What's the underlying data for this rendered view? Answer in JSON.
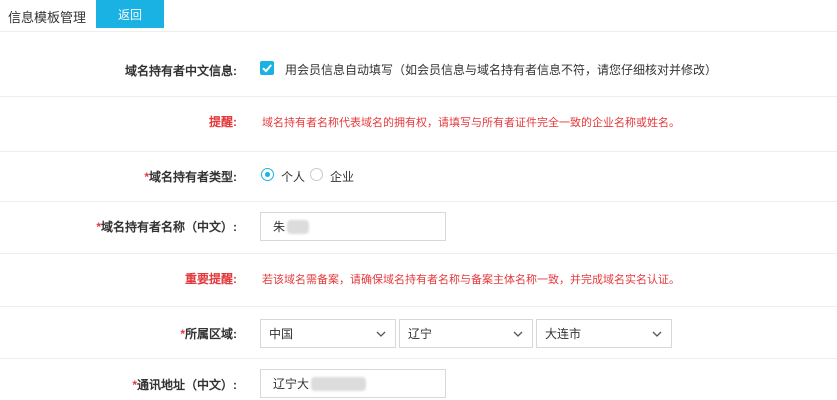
{
  "header": {
    "title": "信息模板管理",
    "back_label": "返回"
  },
  "form": {
    "owner_cn_info": {
      "label": "域名持有者中文信息:",
      "checkbox_text": "用会员信息自动填写（如会员信息与域名持有者信息不符，请您仔细核对并修改）",
      "checked": true
    },
    "reminder": {
      "label": "提醒:",
      "text": "域名持有者名称代表域名的拥有权，请填写与所有者证件完全一致的企业名称或姓名。"
    },
    "owner_type": {
      "required_mark": "*",
      "label": "域名持有者类型:",
      "options": [
        "个人",
        "企业"
      ],
      "selected": "个人"
    },
    "owner_name": {
      "required_mark": "*",
      "label": "域名持有者名称（中文）:",
      "value": "朱"
    },
    "important_reminder": {
      "label": "重要提醒:",
      "text": "若该域名需备案，请确保域名持有者名称与备案主体名称一致，并完成域名实名认证。"
    },
    "region": {
      "required_mark": "*",
      "label": "所属区域:",
      "country": "中国",
      "province": "辽宁",
      "city": "大连市"
    },
    "address": {
      "required_mark": "*",
      "label": "通讯地址（中文）:",
      "value": "辽宁大"
    }
  },
  "colors": {
    "accent": "#19b2e3",
    "warning": "#e4393c"
  }
}
